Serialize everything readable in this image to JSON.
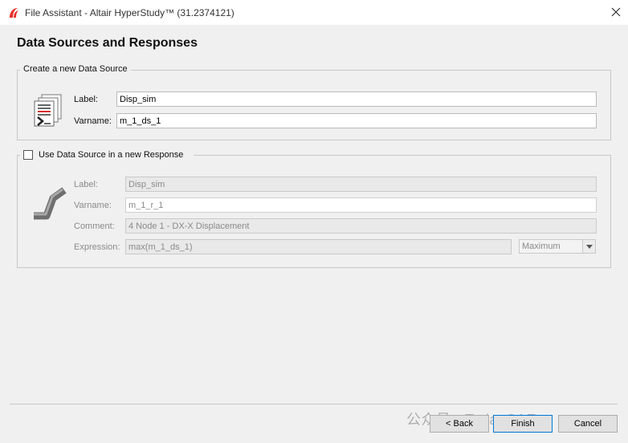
{
  "window": {
    "title": "File Assistant - Altair HyperStudy™ (31.2374121)",
    "close_label": "✕"
  },
  "page_title": "Data Sources and Responses",
  "data_source": {
    "group_title": "Create a new Data Source",
    "label_caption": "Label:",
    "label_value": "Disp_sim",
    "varname_caption": "Varname:",
    "varname_value": "m_1_ds_1",
    "icon": "document-stack-icon"
  },
  "response": {
    "checkbox_label": "Use Data Source in a new Response",
    "checked": false,
    "label_caption": "Label:",
    "label_value": "Disp_sim",
    "varname_caption": "Varname:",
    "varname_value": "m_1_r_1",
    "comment_caption": "Comment:",
    "comment_value": "4 Node 1 - DX-X Displacement",
    "expression_caption": "Expression:",
    "expression_value": "max(m_1_ds_1)",
    "goal_value": "Maximum",
    "icon": "pipe-bend-icon"
  },
  "buttons": {
    "back": "< Back",
    "finish": "Finish",
    "cancel": "Cancel"
  },
  "watermark": "公众号 · TodayCAEer"
}
